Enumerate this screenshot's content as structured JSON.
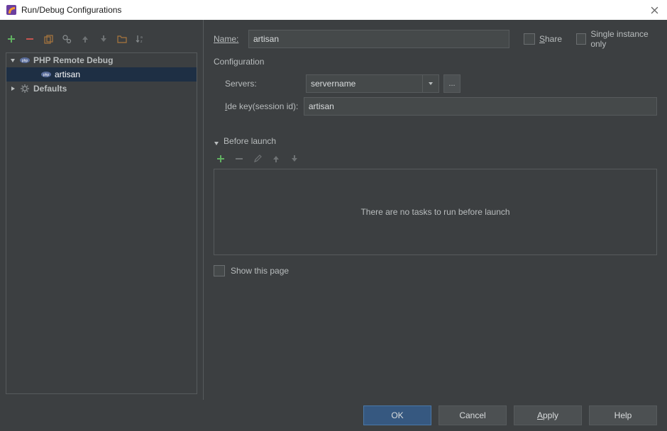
{
  "window": {
    "title": "Run/Debug Configurations"
  },
  "toolbar_icons": {
    "add": "add",
    "remove": "remove",
    "copy": "copy",
    "settings": "settings",
    "up": "up",
    "down": "down",
    "folder": "folder",
    "sort": "sort"
  },
  "tree": {
    "nodes": [
      {
        "label": "PHP Remote Debug",
        "expanded": true
      },
      {
        "label": "artisan",
        "selected": true
      },
      {
        "label": "Defaults",
        "expanded": false
      }
    ]
  },
  "form": {
    "name_label": "ame:",
    "name_underline_prefix": "N",
    "name_value": "artisan",
    "share_label": "hare",
    "share_underline_prefix": "S",
    "single_instance_label": "Single instance only",
    "config_section": "Configuration",
    "servers_label": "Servers:",
    "servers_value": "servername",
    "ellipsis": "...",
    "ide_label_prefix": "I",
    "ide_label_rest": "de key(session id):",
    "ide_value": "artisan",
    "before_launch_prefix": "B",
    "before_launch_rest": "efore launch",
    "bl_empty": "There are no tasks to run before launch",
    "show_page_label": "Show this page"
  },
  "footer": {
    "ok": "OK",
    "cancel": "Cancel",
    "apply_prefix": "A",
    "apply_rest": "pply",
    "help": "Help"
  }
}
